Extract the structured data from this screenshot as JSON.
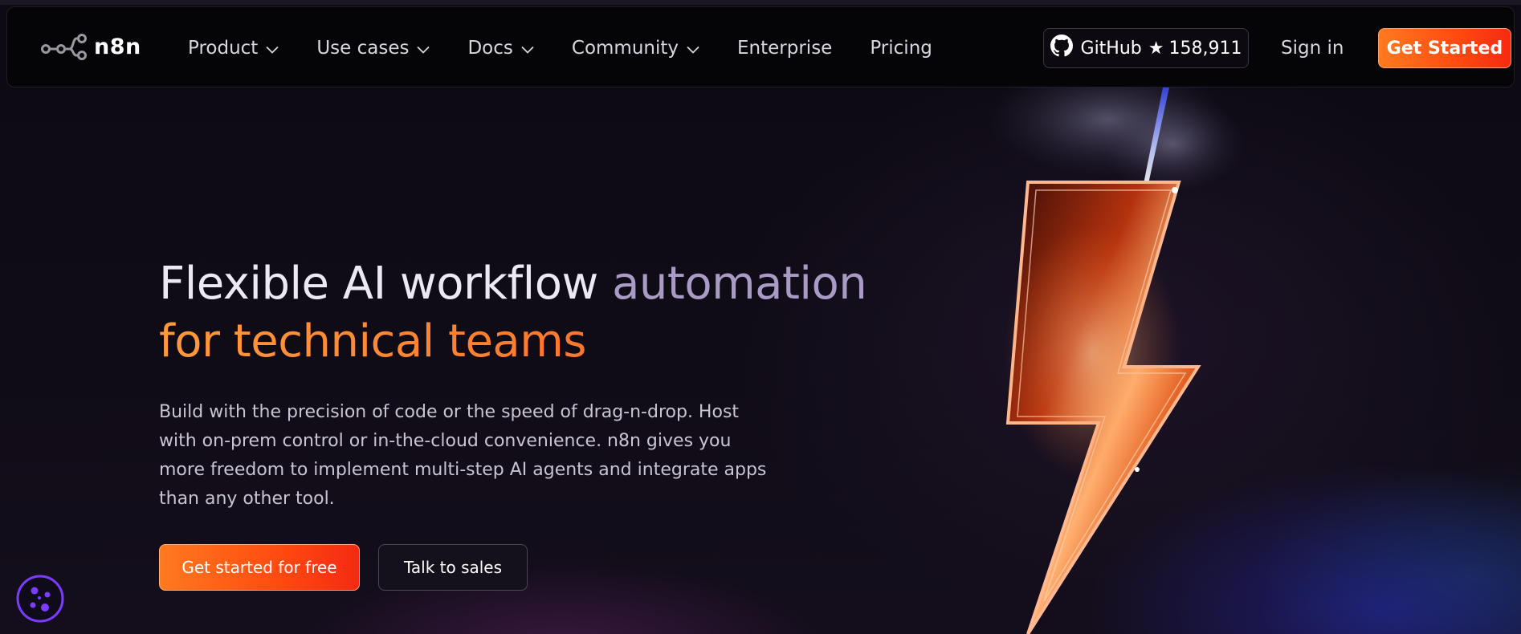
{
  "brand": {
    "name": "n8n",
    "accent_color": "#ff5a1f",
    "logo_icon": "n8n-nodes-logo"
  },
  "nav": {
    "items": [
      {
        "label": "Product",
        "has_dropdown": true
      },
      {
        "label": "Use cases",
        "has_dropdown": true
      },
      {
        "label": "Docs",
        "has_dropdown": true
      },
      {
        "label": "Community",
        "has_dropdown": true
      },
      {
        "label": "Enterprise",
        "has_dropdown": false
      },
      {
        "label": "Pricing",
        "has_dropdown": false
      }
    ],
    "github": {
      "label": "GitHub",
      "star": "★",
      "stars": "158,911",
      "icon": "github-icon"
    },
    "signin_label": "Sign in",
    "get_started_label": "Get Started"
  },
  "hero": {
    "title_part1": "Flexible AI workflow ",
    "title_part2": "automation",
    "title_line2": "for technical teams",
    "description": "Build with the precision of code or the speed of drag-n-drop. Host with on-prem control or in-the-cloud convenience. n8n gives you more freedom to implement multi-step AI agents and integrate apps than any other tool.",
    "cta_primary": "Get started for free",
    "cta_secondary": "Talk to sales",
    "illustration": "lightning-bolt-illustration"
  },
  "cookie": {
    "icon": "cookie-icon"
  }
}
